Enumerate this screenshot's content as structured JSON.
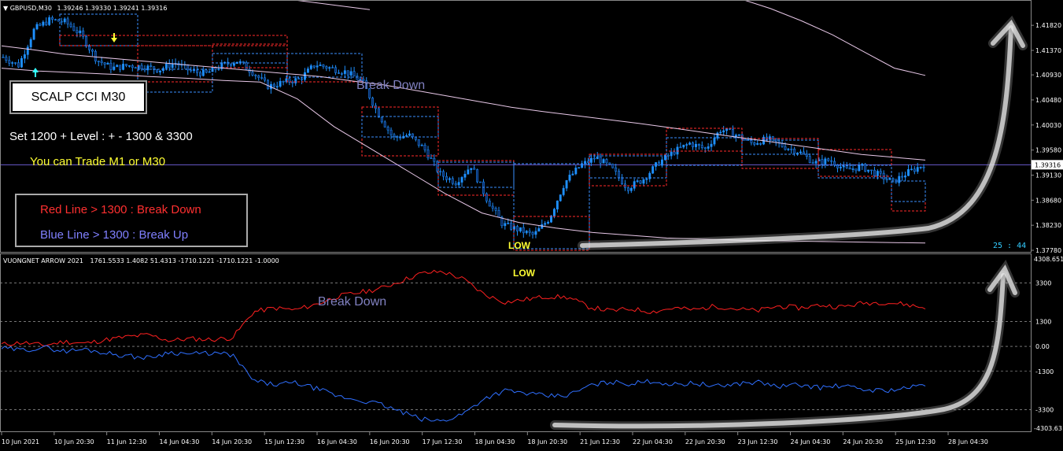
{
  "main_header": {
    "symbol": "GBPUSD,M30",
    "ohlc": "1.39246 1.39330 1.39241 1.39316"
  },
  "sub_header": {
    "indicator": "VUONGNET ARROW 2021",
    "values": "1761.5533 1.4082 51.4313 -1710.1221 -1710.1221 -1.0000"
  },
  "annotations": {
    "scalp_title": "SCALP CCI M30",
    "settings": "Set 1200 + Level : + - 1300 & 3300",
    "trade_tf": "You can Trade M1 or M30",
    "red_rule": "Red Line > 1300 : Break Down",
    "blue_rule": "Blue Line > 1300 : Break Up",
    "break_down_main": "Break Down",
    "break_down_sub": "Break Down",
    "low_main": "LOW",
    "low_sub": "LOW",
    "timer": "25 : 44"
  },
  "colors": {
    "background": "#000000",
    "bull": "#1e90ff",
    "bear": "#1e90ff",
    "red_line": "#ff2020",
    "blue_line": "#2f6fff",
    "ma": "#e8c8e8",
    "level_dash": "#bbbbbb",
    "box_red": "#ff2a2a",
    "box_blue": "#3a8fff",
    "annotation_yellow": "#ffff33",
    "annotation_red": "#ff3030",
    "annotation_blue": "#8080ff",
    "timer_cyan": "#33ccff",
    "current_price_line": "#6a5acd"
  },
  "chart_data": [
    {
      "type": "candlestick",
      "title": "GBPUSD,M30",
      "y_ticks": [
        "1.41820",
        "1.41370",
        "1.40930",
        "1.40480",
        "1.40030",
        "1.39580",
        "1.39130",
        "1.38680",
        "1.38230",
        "1.37780"
      ],
      "current_price": "1.39316",
      "ylim": [
        1.3778,
        1.4202
      ],
      "x_ticks": [
        "10 Jun 2021",
        "10 Jun 20:30",
        "11 Jun 12:30",
        "14 Jun 04:30",
        "14 Jun 20:30",
        "15 Jun 12:30",
        "16 Jun 04:30",
        "16 Jun 20:30",
        "17 Jun 12:30",
        "18 Jun 04:30",
        "18 Jun 20:30",
        "21 Jun 12:30",
        "22 Jun 04:30",
        "22 Jun 20:30",
        "23 Jun 12:30",
        "24 Jun 04:30",
        "24 Jun 20:30",
        "25 Jun 12:30",
        "28 Jun 04:30"
      ],
      "close_path": [
        1.4125,
        1.411,
        1.4175,
        1.4192,
        1.4188,
        1.4165,
        1.412,
        1.4105,
        1.411,
        1.4108,
        1.4102,
        1.4115,
        1.41,
        1.4095,
        1.411,
        1.4118,
        1.4098,
        1.4072,
        1.408,
        1.4085,
        1.4112,
        1.4105,
        1.4098,
        1.4082,
        1.4025,
        1.398,
        1.3985,
        1.396,
        1.3915,
        1.39,
        1.393,
        1.387,
        1.3825,
        1.3815,
        1.3805,
        1.3835,
        1.39,
        1.393,
        1.3945,
        1.3925,
        1.389,
        1.3905,
        1.3935,
        1.3955,
        1.397,
        1.396,
        1.3995,
        1.3985,
        1.397,
        1.3978,
        1.3965,
        1.3955,
        1.3935,
        1.394,
        1.3922,
        1.3928,
        1.3915,
        1.39,
        1.3918,
        1.3932
      ],
      "ma_slow": [
        1.4145,
        1.4138,
        1.413,
        1.4125,
        1.412,
        1.4115,
        1.411,
        1.4105,
        1.41,
        1.4095,
        1.409,
        1.4082,
        1.4075,
        1.4065,
        1.4055,
        1.4045,
        1.4035,
        1.4027,
        1.402,
        1.4013,
        1.4006,
        1.3998,
        1.399,
        1.3982,
        1.3974,
        1.3966,
        1.3958,
        1.395,
        1.3945,
        1.394
      ],
      "ma_fast": [
        1.4105,
        1.41,
        1.4097,
        1.4094,
        1.409,
        1.4087,
        1.4083,
        1.408,
        1.405,
        1.4,
        1.396,
        1.392,
        1.388,
        1.3845,
        1.3828,
        1.3818,
        1.381,
        1.3805,
        1.38,
        1.3798,
        1.3796,
        1.3795,
        1.3794,
        1.3793,
        1.3792,
        1.3791
      ],
      "ma_top": [
        1.423,
        1.4212,
        1.419,
        1.4165,
        1.4135,
        1.4105,
        1.4092
      ]
    },
    {
      "type": "line",
      "title": "VUONGNET ARROW 2021",
      "y_ticks": [
        "3300",
        "1300",
        "0.00",
        "-1300",
        "-3300"
      ],
      "ylim": [
        -4303.63,
        4308.651
      ],
      "ylim_labels": [
        "4308.651",
        "-4303.63"
      ],
      "levels": [
        3300,
        1300,
        0,
        -1300,
        -3300
      ],
      "series": [
        {
          "color": "red",
          "values": [
            100,
            200,
            50,
            250,
            150,
            350,
            500,
            600,
            300,
            400,
            350,
            450,
            1800,
            2000,
            1900,
            2200,
            2600,
            2800,
            3000,
            3400,
            3800,
            3900,
            3500,
            2700,
            2300,
            2450,
            2600,
            2550,
            2050,
            1850,
            1950,
            1800,
            2000,
            1900,
            2100,
            1950,
            1850,
            2100,
            2000,
            2150,
            2050,
            2250,
            2300,
            2200,
            2000
          ]
        },
        {
          "color": "blue",
          "values": [
            -100,
            -200,
            -50,
            -250,
            -150,
            -350,
            -500,
            -600,
            -300,
            -400,
            -350,
            -450,
            -1800,
            -2000,
            -1900,
            -2200,
            -2600,
            -2800,
            -3000,
            -3400,
            -3800,
            -3900,
            -3500,
            -2700,
            -2300,
            -2450,
            -2600,
            -2550,
            -2050,
            -1850,
            -1950,
            -1800,
            -2000,
            -1900,
            -2100,
            -1950,
            -1850,
            -2100,
            -2000,
            -2150,
            -2050,
            -2250,
            -2300,
            -2200,
            -2000
          ]
        }
      ]
    }
  ]
}
